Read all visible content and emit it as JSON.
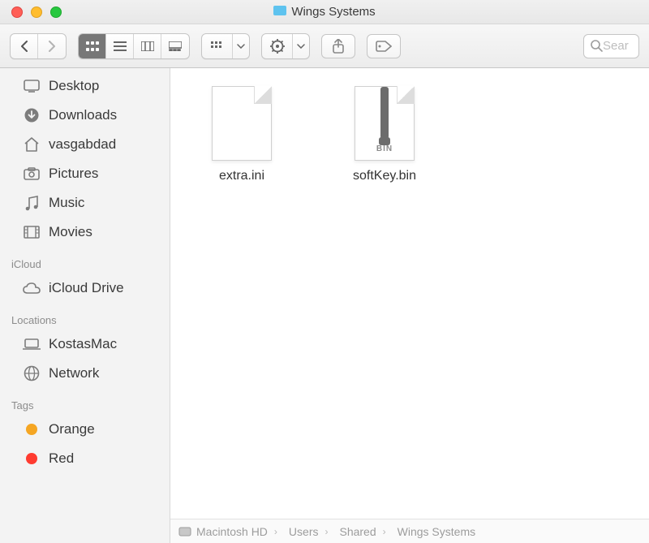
{
  "window": {
    "title": "Wings Systems"
  },
  "toolbar": {
    "search_placeholder": "Sear"
  },
  "sidebar": {
    "favorites": [
      {
        "label": "Desktop",
        "icon": "desktop"
      },
      {
        "label": "Downloads",
        "icon": "downloads"
      },
      {
        "label": "vasgabdad",
        "icon": "home"
      },
      {
        "label": "Pictures",
        "icon": "pictures"
      },
      {
        "label": "Music",
        "icon": "music"
      },
      {
        "label": "Movies",
        "icon": "movies"
      }
    ],
    "sections": [
      {
        "heading": "iCloud",
        "items": [
          {
            "label": "iCloud Drive",
            "icon": "cloud"
          }
        ]
      },
      {
        "heading": "Locations",
        "items": [
          {
            "label": "KostasMac",
            "icon": "laptop"
          },
          {
            "label": "Network",
            "icon": "network"
          }
        ]
      },
      {
        "heading": "Tags",
        "items": [
          {
            "label": "Orange",
            "icon": "tag",
            "color": "#f5a623"
          },
          {
            "label": "Red",
            "icon": "tag",
            "color": "#ff3b30"
          }
        ]
      }
    ]
  },
  "content": {
    "files": [
      {
        "name": "extra.ini",
        "kind": "generic"
      },
      {
        "name": "softKey.bin",
        "kind": "bin",
        "badge": "BIN"
      }
    ]
  },
  "pathbar": [
    {
      "label": "Macintosh HD",
      "icon": "disk"
    },
    {
      "label": "Users",
      "icon": "folder"
    },
    {
      "label": "Shared",
      "icon": "folder"
    },
    {
      "label": "Wings Systems",
      "icon": "folder"
    }
  ],
  "colors": {
    "folder_blue": "#5ec3ef",
    "sidebar_icon": "#7c7c7c"
  }
}
